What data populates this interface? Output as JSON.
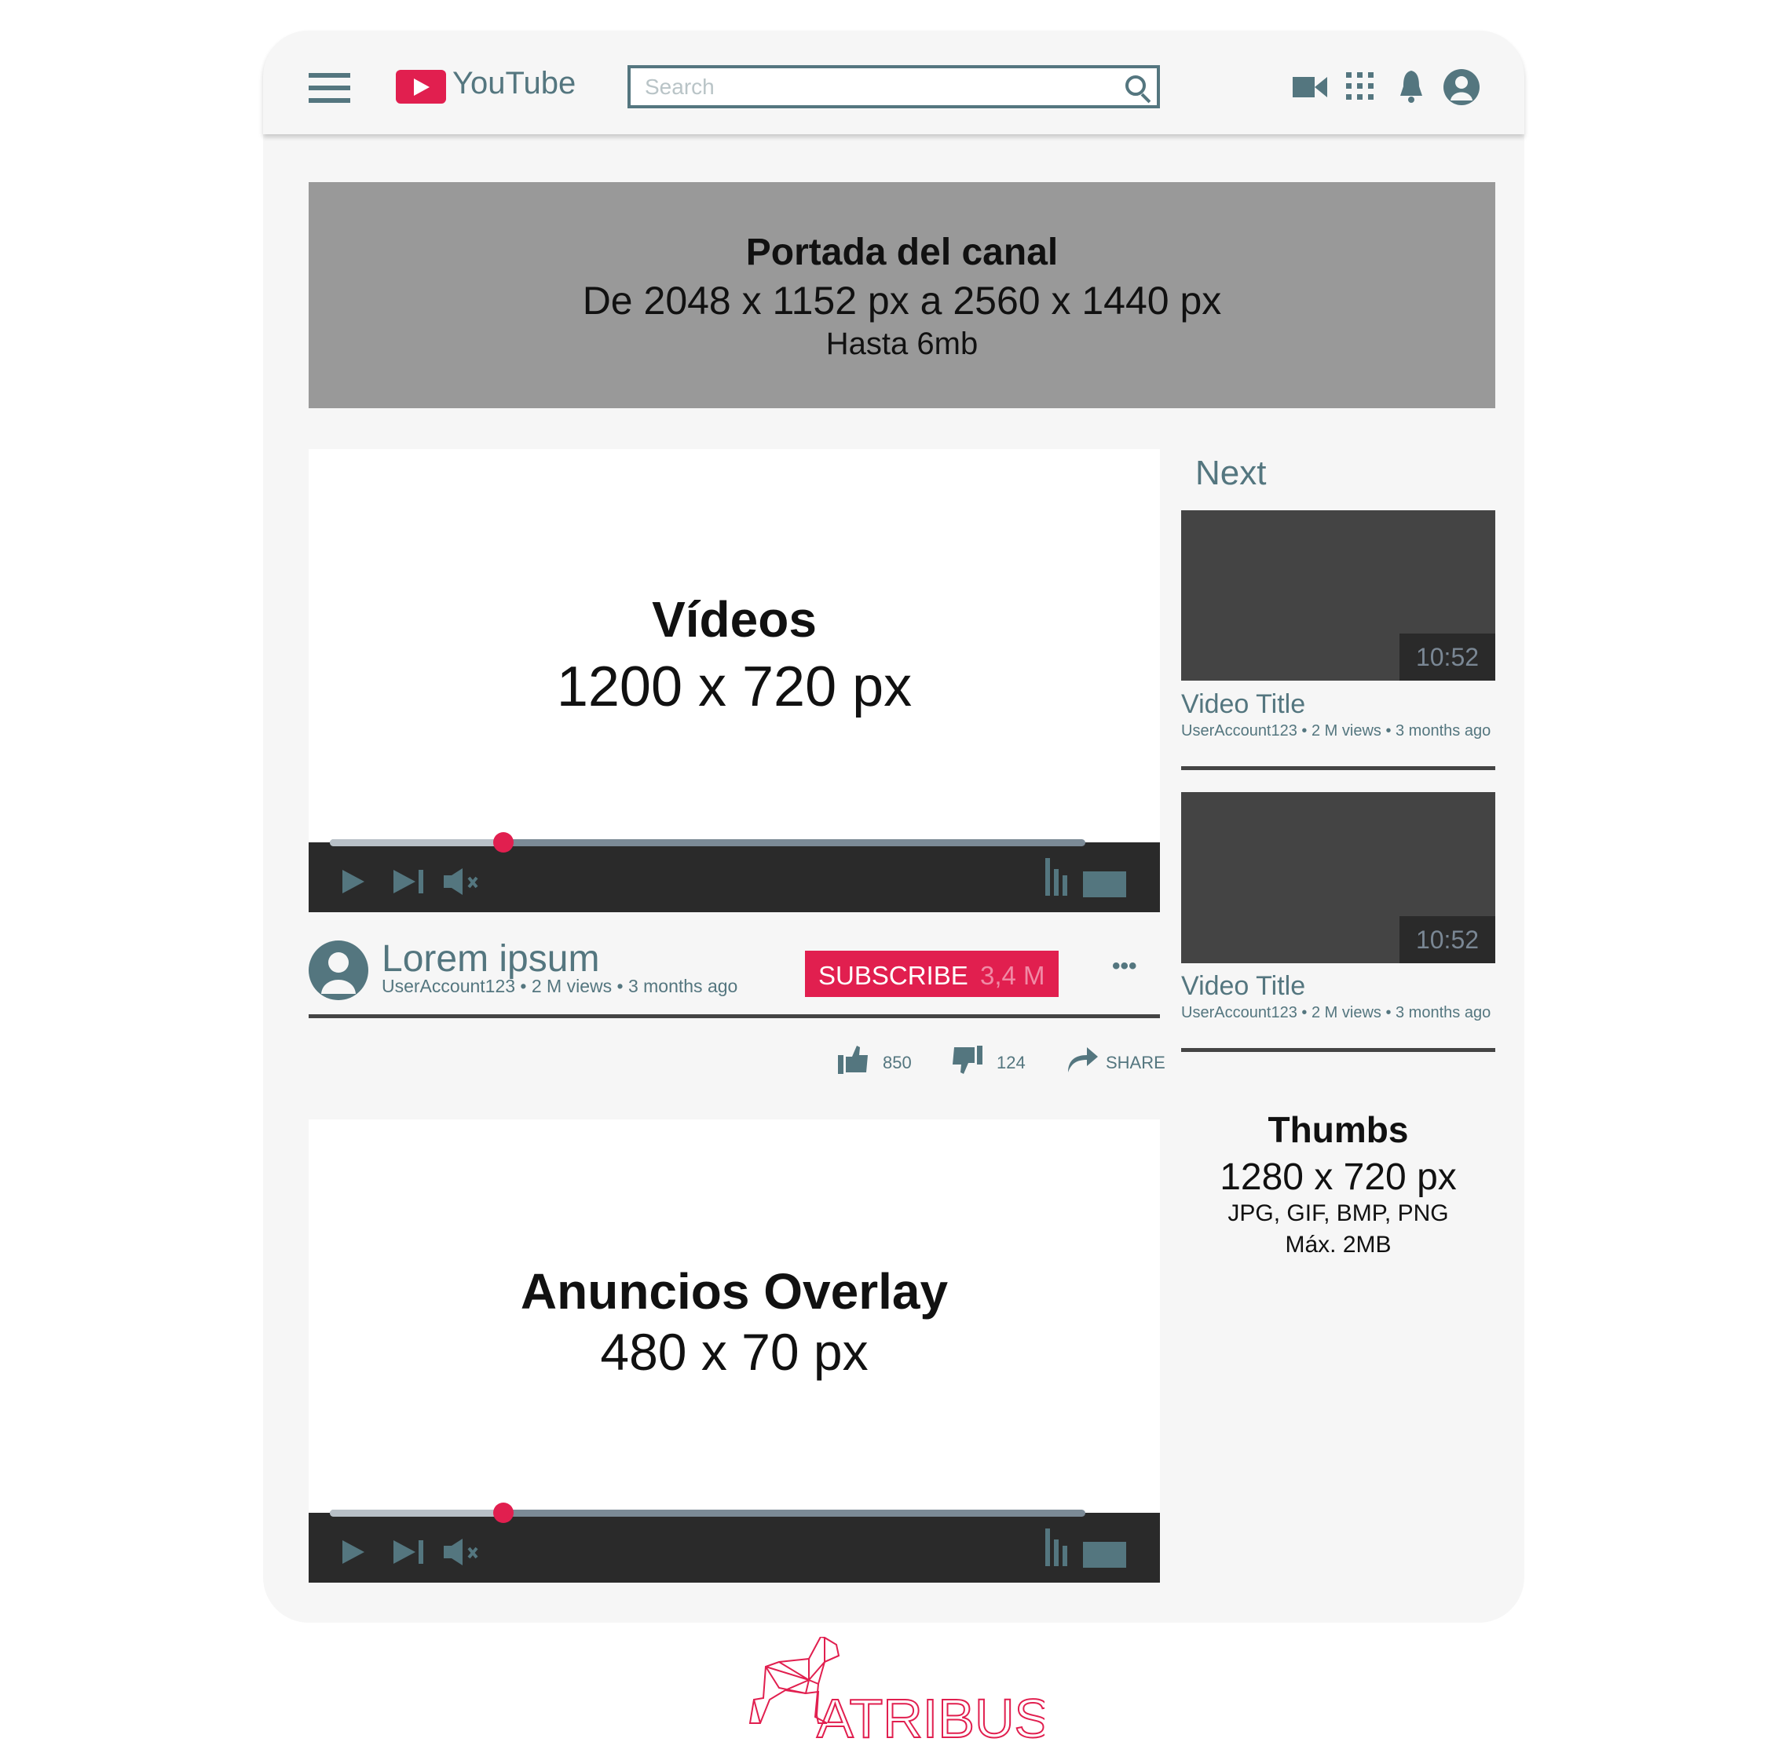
{
  "header": {
    "brand": "YouTube",
    "search_placeholder": "Search",
    "icons": [
      "menu-icon",
      "search-icon",
      "video-camera-icon",
      "apps-grid-icon",
      "bell-icon",
      "account-icon"
    ]
  },
  "banner": {
    "title": "Portada del canal",
    "size": "De 2048 x 1152 px a 2560 x 1440 px",
    "limit": "Hasta 6mb"
  },
  "main_video": {
    "title": "Vídeos",
    "size": "1200 x 720 px",
    "progress_percent": 23
  },
  "channel": {
    "name": "Lorem ipsum",
    "meta": "UserAccount123 • 2 M views • 3 months ago",
    "subscribe_label": "SUBSCRIBE",
    "subscriber_count": "3,4 M",
    "more_label": "•••"
  },
  "actions": {
    "likes": "850",
    "dislikes": "124",
    "share_label": "SHARE"
  },
  "ad_video": {
    "title": "Anuncios Overlay",
    "size": "480 x 70 px",
    "progress_percent": 23
  },
  "sidebar": {
    "heading": "Next",
    "items": [
      {
        "duration": "10:52",
        "title": "Video Title",
        "meta": "UserAccount123 • 2 M views • 3 months ago"
      },
      {
        "duration": "10:52",
        "title": "Video Title",
        "meta": "UserAccount123 • 2 M views • 3 months ago"
      }
    ],
    "thumbs_info": {
      "title": "Thumbs",
      "size": "1280 x 720 px",
      "formats": "JPG, GIF, BMP, PNG",
      "max": "Máx. 2MB"
    }
  },
  "footer": {
    "logo_text": "ATRIBUS"
  },
  "colors": {
    "accent": "#e11f4f",
    "icon": "#54767f",
    "player_bar": "#2a2a2a",
    "thumbnail": "#444444",
    "banner": "#999999"
  }
}
